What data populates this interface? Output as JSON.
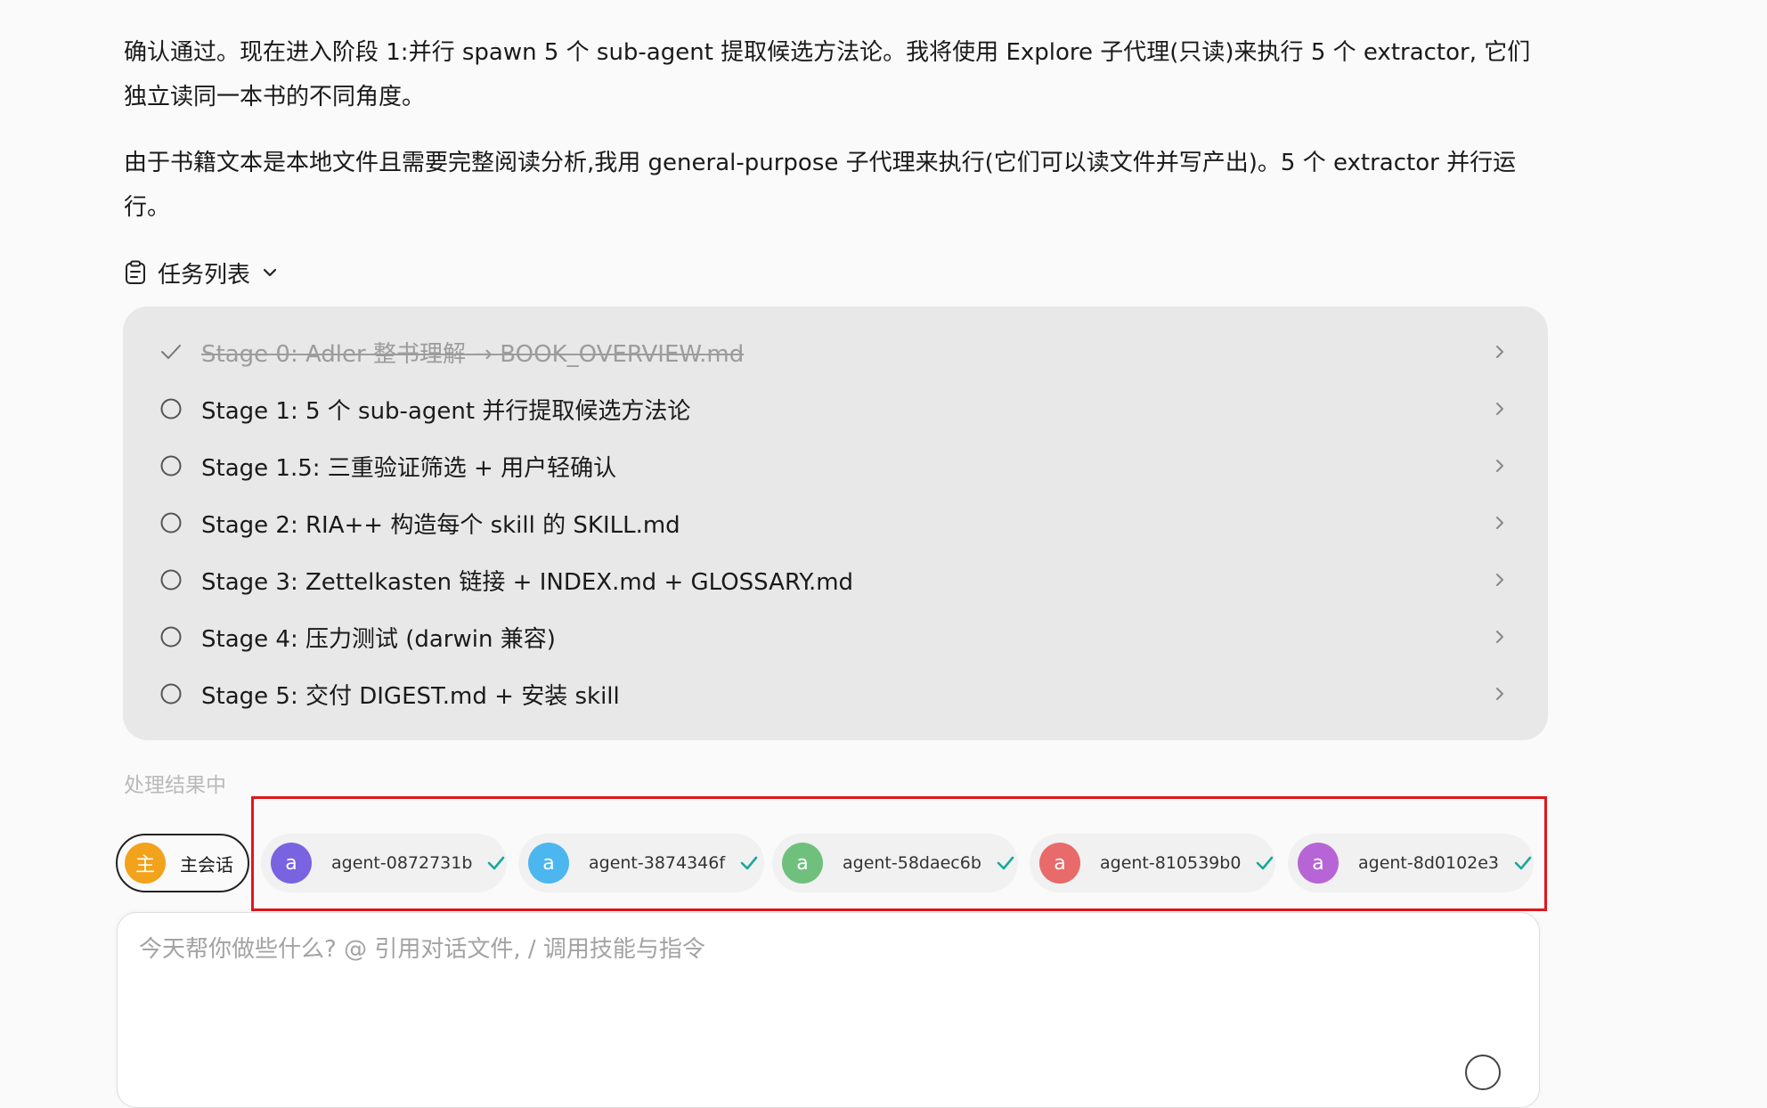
{
  "message": {
    "paragraph_1": "确认通过。现在进入阶段 1:并行 spawn 5 个 sub-agent 提取候选方法论。我将使用 Explore 子代理(只读)来执行 5 个 extractor, 它们独立读同一本书的不同角度。",
    "paragraph_2": "由于书籍文本是本地文件且需要完整阅读分析,我用 general-purpose 子代理来执行(它们可以读文件并写产出)。5 个 extractor 并行运行。"
  },
  "todo": {
    "title": "任务列表",
    "icons": {
      "header": "clipboard-icon",
      "toggle": "chevron-down-icon"
    },
    "items": [
      {
        "label": "Stage 0: Adler 整书理解 → BOOK_OVERVIEW.md",
        "status": "done"
      },
      {
        "label": "Stage 1: 5 个 sub-agent 并行提取候选方法论",
        "status": "pending"
      },
      {
        "label": "Stage 1.5: 三重验证筛选 + 用户轻确认",
        "status": "pending"
      },
      {
        "label": "Stage 2: RIA++ 构造每个 skill 的 SKILL.md",
        "status": "pending"
      },
      {
        "label": "Stage 3: Zettelkasten 链接 + INDEX.md + GLOSSARY.md",
        "status": "pending"
      },
      {
        "label": "Stage 4: 压力测试 (darwin 兼容)",
        "status": "pending"
      },
      {
        "label": "Stage 5: 交付 DIGEST.md + 安装 skill",
        "status": "pending"
      }
    ]
  },
  "processing_text": "处理结果中",
  "sessions": {
    "main": {
      "avatar": "主",
      "label": "主会话",
      "color": "#f2a21b"
    },
    "agents": [
      {
        "avatar": "a",
        "label": "agent-0872731b",
        "color": "#7a63e0",
        "status": "complete"
      },
      {
        "avatar": "a",
        "label": "agent-3874346f",
        "color": "#4cb7ef",
        "status": "complete"
      },
      {
        "avatar": "a",
        "label": "agent-58daec6b",
        "color": "#6fc07d",
        "status": "complete"
      },
      {
        "avatar": "a",
        "label": "agent-810539b0",
        "color": "#e86a6a",
        "status": "complete"
      },
      {
        "avatar": "a",
        "label": "agent-8d0102e3",
        "color": "#b765d6",
        "status": "complete"
      }
    ],
    "check_color": "#1aa89a"
  },
  "input": {
    "placeholder": "今天帮你做些什么? @ 引用对话文件, / 调用技能与指令",
    "value": ""
  }
}
